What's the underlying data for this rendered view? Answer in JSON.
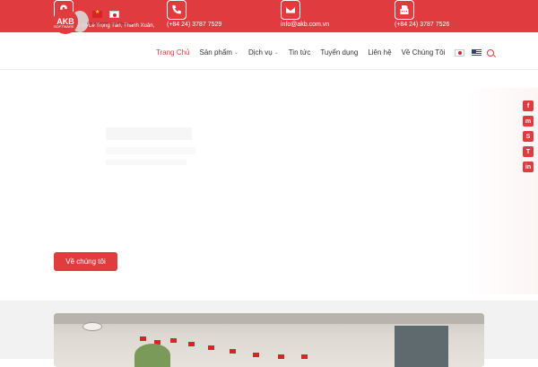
{
  "topbar": {
    "address": "Số 15, ngõ 64 Lê Trọng Tấn, Thanh Xuân,",
    "phone": "(+84 24) 3787 7529",
    "email": "info@akb.com.vn",
    "fax": "(+84 24) 3787 7526",
    "address_icon": "map-pin-icon",
    "phone_icon": "phone-icon",
    "email_icon": "envelope-icon",
    "fax_icon": "fax-icon"
  },
  "logo": {
    "letters": "AKB",
    "sub": "SOFTWARE",
    "slogan": "Good Partner, Great Success"
  },
  "nav": {
    "items": [
      {
        "label": "Trang Chủ",
        "active": true
      },
      {
        "label": "Sản phẩm",
        "dropdown": true
      },
      {
        "label": "Dịch vụ",
        "dropdown": true
      },
      {
        "label": "Tin tức"
      },
      {
        "label": "Tuyển dụng"
      },
      {
        "label": "Liên hệ"
      },
      {
        "label": "Về Chúng Tôi"
      }
    ],
    "languages": [
      "Japanese",
      "English"
    ]
  },
  "hero": {
    "button_label": "Về chúng tôi"
  },
  "social": {
    "items": [
      "f",
      "m",
      "S",
      "T",
      "in"
    ]
  },
  "colors": {
    "accent": "#e03c3f",
    "bottom_bg": "#f2f2f2"
  }
}
